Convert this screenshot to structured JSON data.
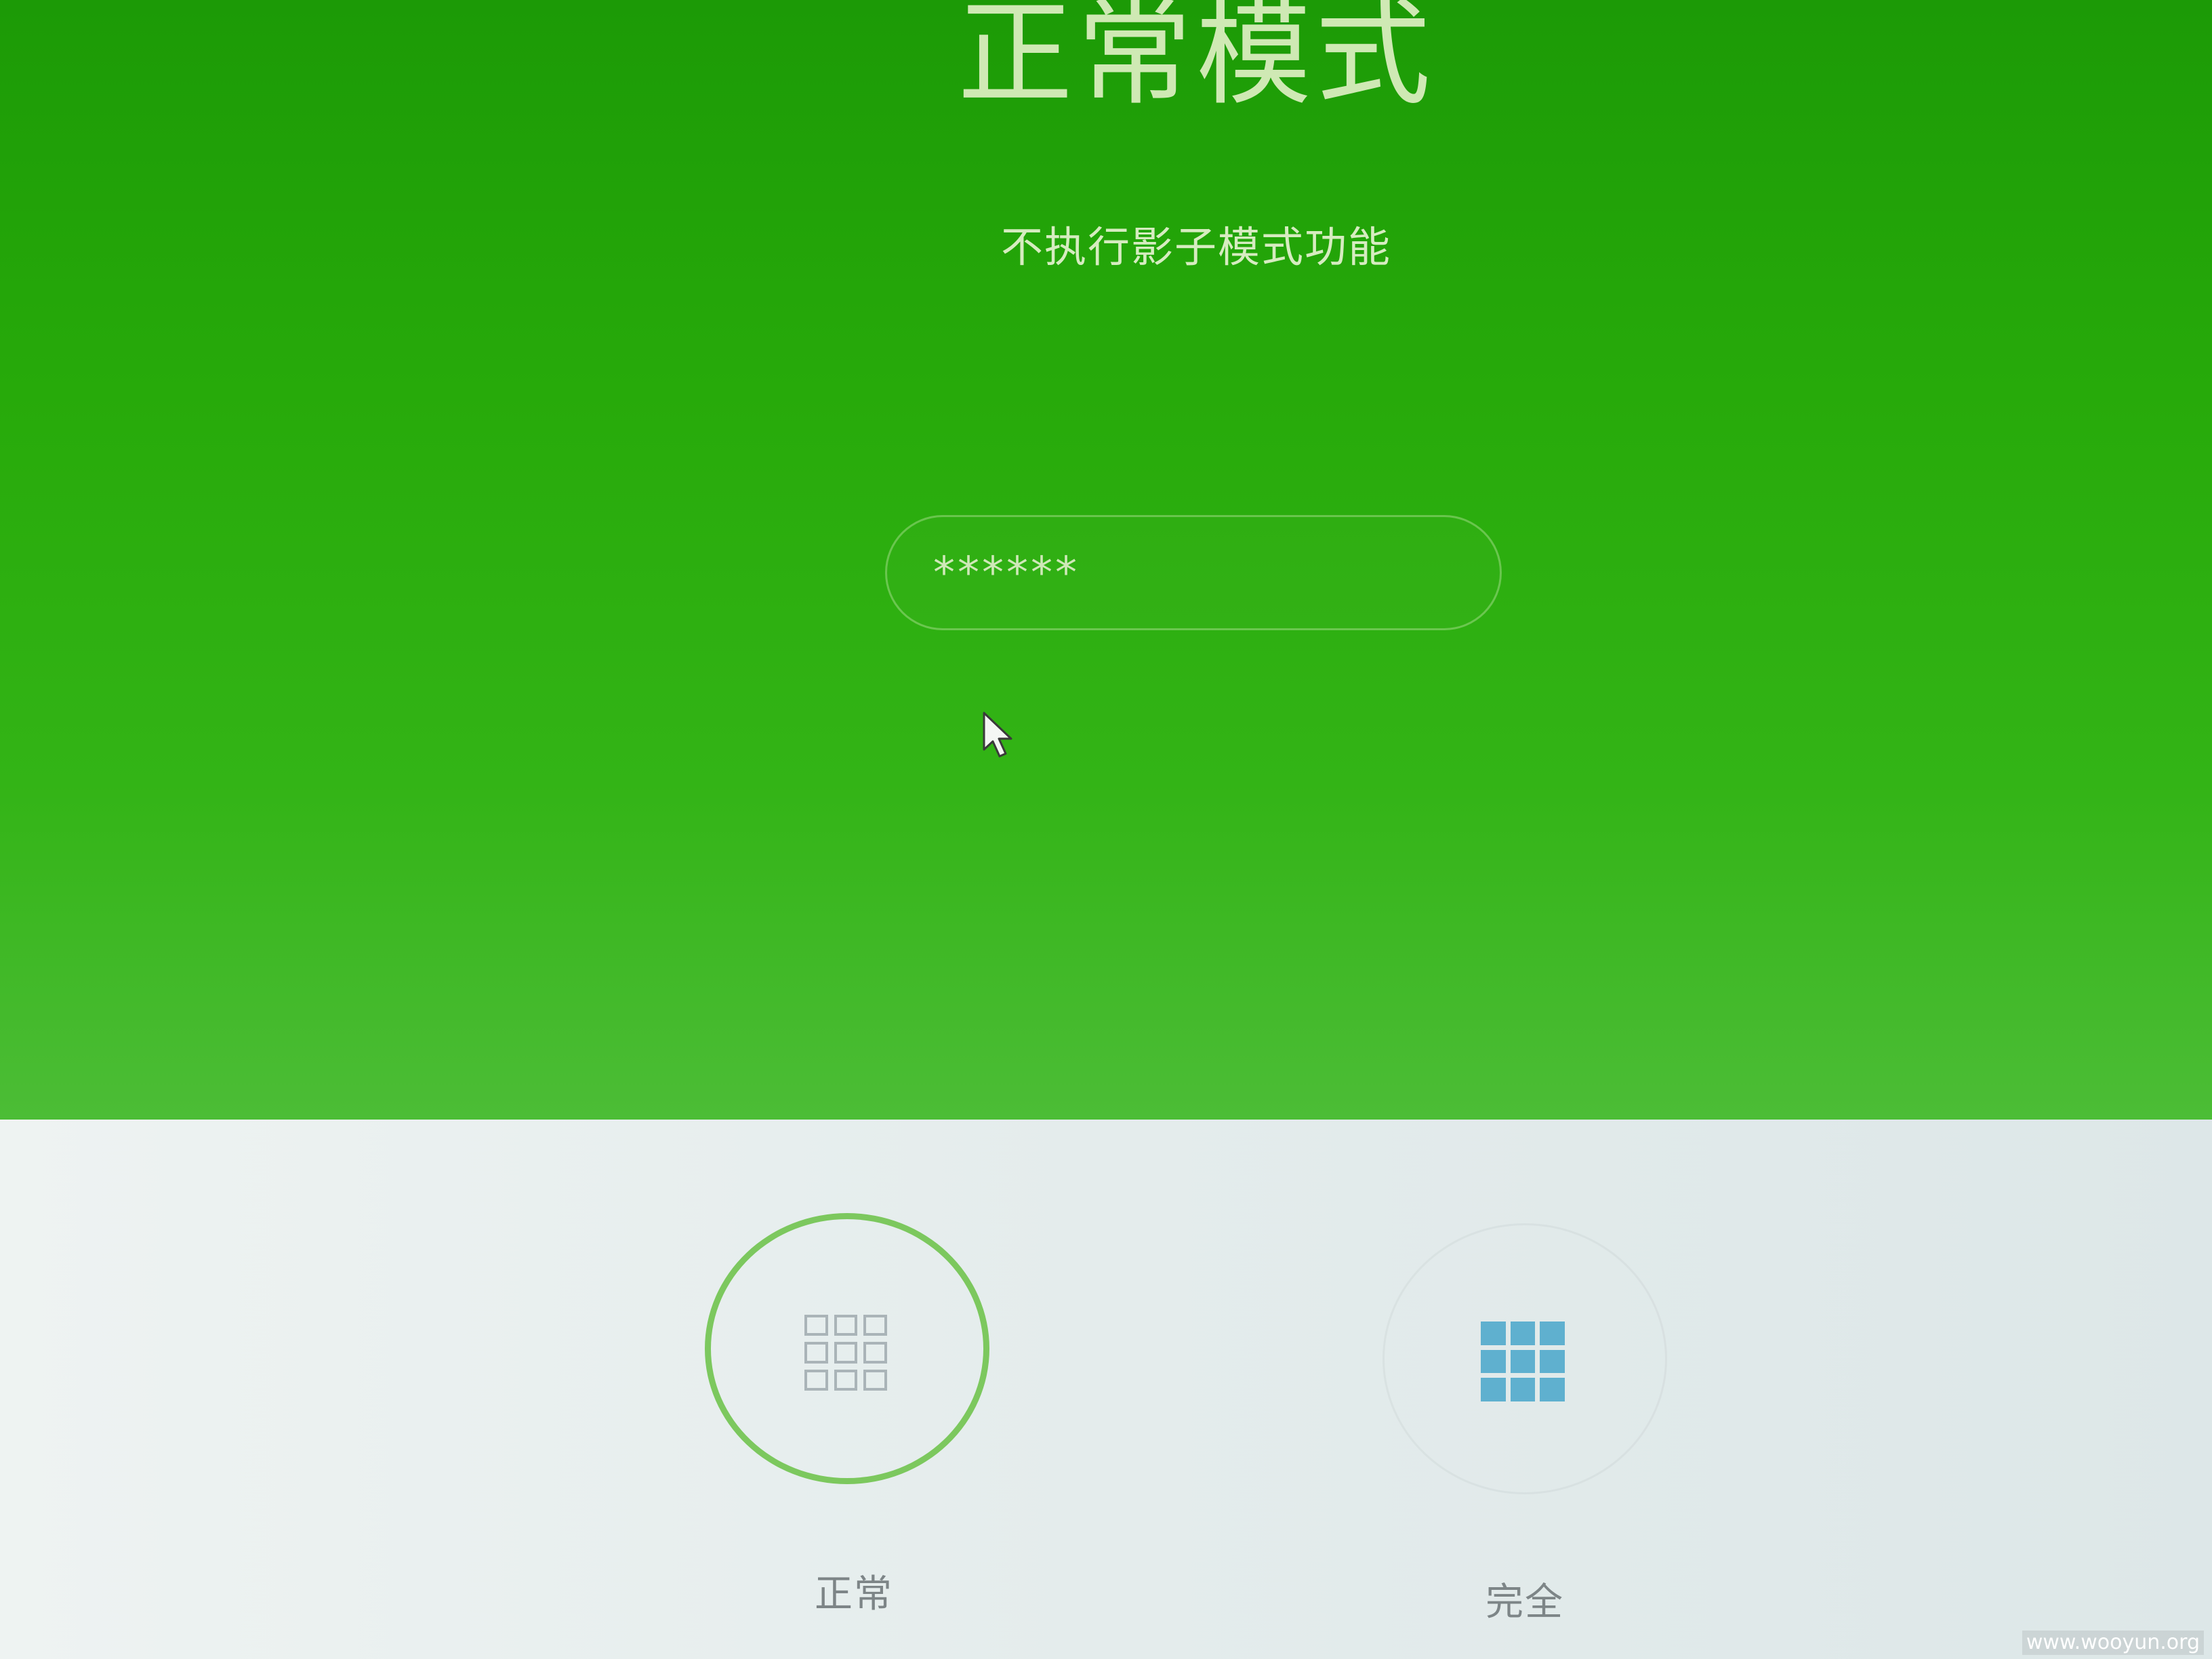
{
  "header": {
    "title": "正常模式",
    "description": "不执行影子模式功能"
  },
  "password": {
    "value": "******"
  },
  "modes": [
    {
      "label": "正常",
      "icon": "grid-outline-icon",
      "selected": true
    },
    {
      "label": "完全",
      "icon": "grid-solid-icon",
      "selected": false
    }
  ],
  "watermark": "www.wooyun.org",
  "colors": {
    "accent": "#28aa0a",
    "selected_ring": "#7cc85e",
    "full_icon": "#5fb0cf",
    "panel_bg": "#e4ecec"
  }
}
